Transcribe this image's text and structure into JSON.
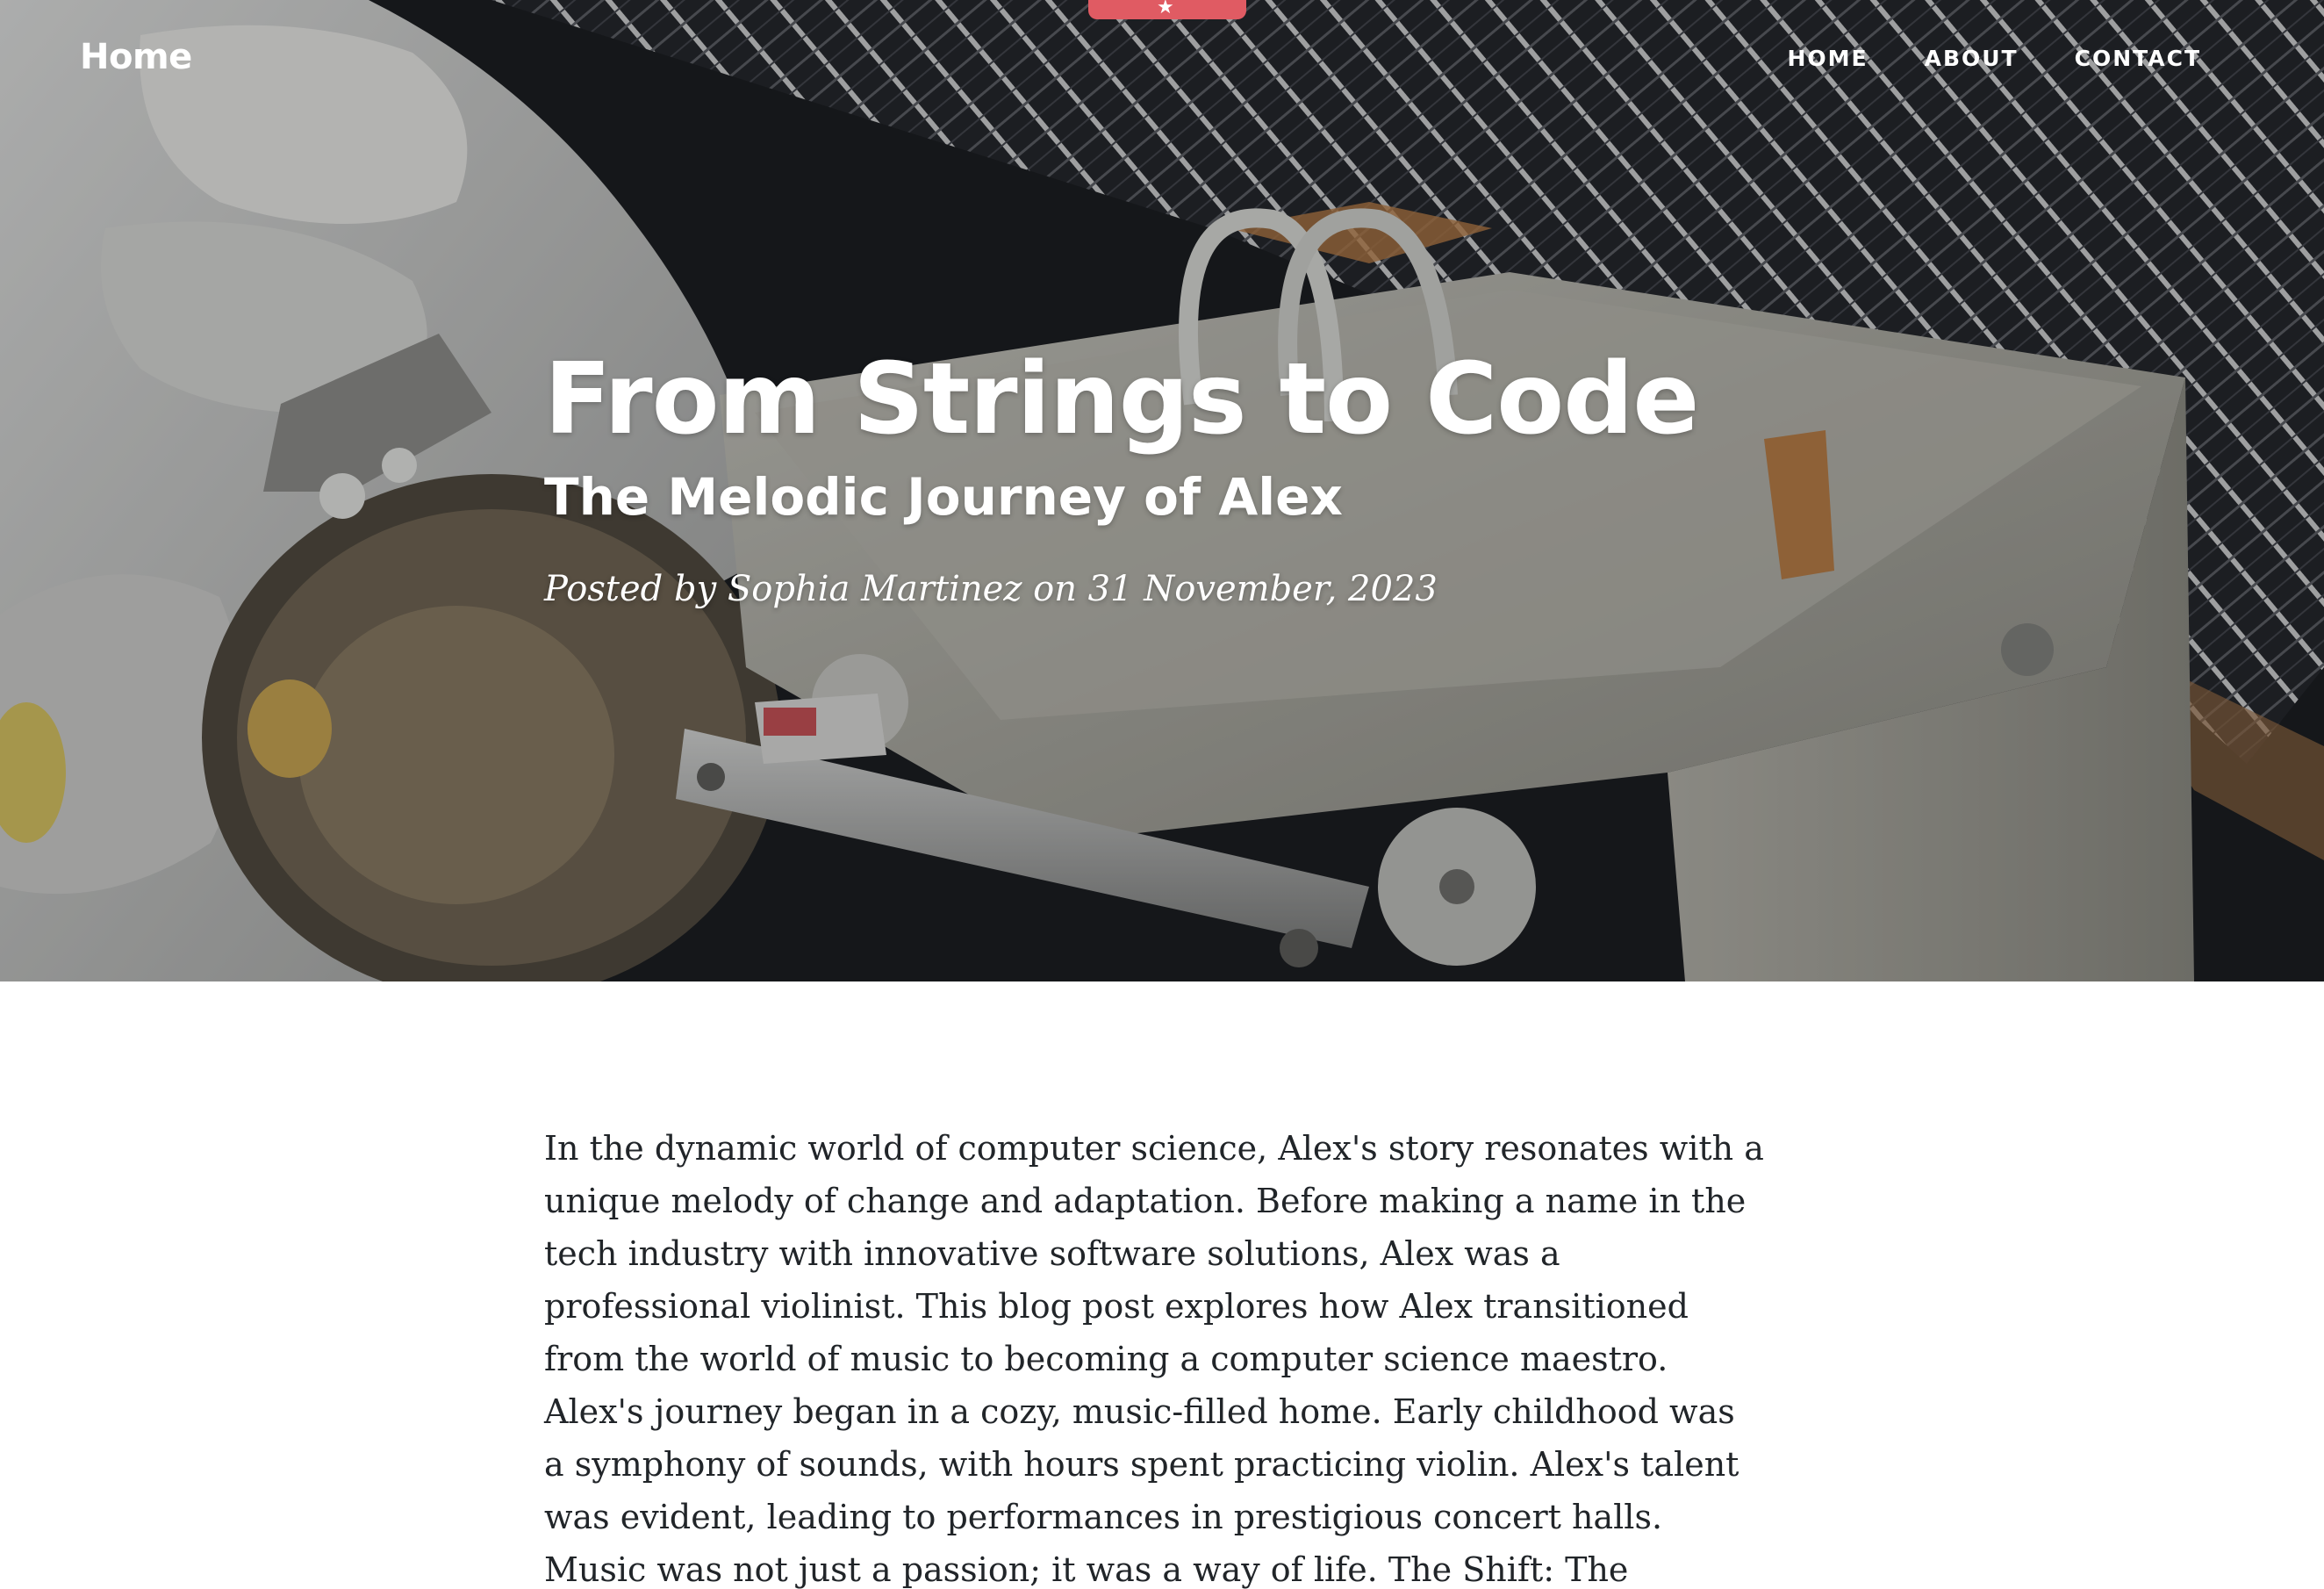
{
  "navbar": {
    "brand": "Home",
    "links": [
      "HOME",
      "ABOUT",
      "CONTACT"
    ],
    "tab_icon": "rocket-icon"
  },
  "post": {
    "title": "From Strings to Code",
    "subtitle": "The Melodic Journey of Alex",
    "meta": "Posted by Sophia Martinez on 31 November, 2023",
    "body": "In the dynamic world of computer science, Alex's story resonates with a unique melody of change and adaptation. Before making a name in the tech industry with innovative software solutions, Alex was a professional violinist. This blog post explores how Alex transitioned from the world of music to becoming a computer science maestro. Alex's journey began in a cozy, music-filled home. Early childhood was a symphony of sounds, with hours spent practicing violin. Alex's talent was evident, leading to performances in prestigious concert halls. Music was not just a passion; it was a way of life. The Shift: The transition from music to computer"
  },
  "colors": {
    "accent": "#e05b63",
    "text": "#212529",
    "hero_overlay": "#212529"
  }
}
